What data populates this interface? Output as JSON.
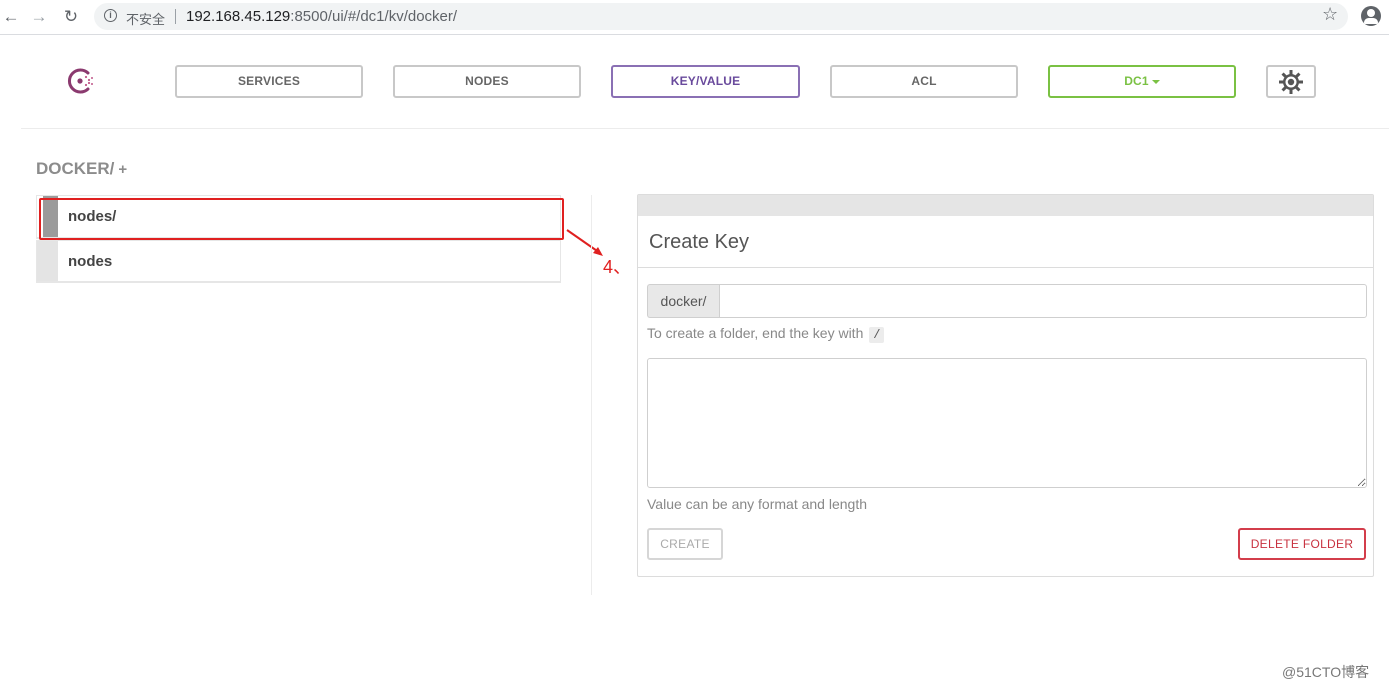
{
  "browser": {
    "security_label": "不安全",
    "url_host": "192.168.45.129",
    "url_rest": ":8500/ui/#/dc1/kv/docker/"
  },
  "nav": {
    "services": "SERVICES",
    "nodes": "NODES",
    "key_value": "KEY/VALUE",
    "acl": "ACL",
    "datacenter": "DC1"
  },
  "breadcrumb": {
    "path": "DOCKER/",
    "add": "+"
  },
  "kv_items": [
    {
      "label": "nodes/"
    },
    {
      "label": "nodes"
    }
  ],
  "annotation": "4、",
  "create_key": {
    "title": "Create Key",
    "key_prefix": "docker/",
    "key_value": "",
    "folder_hint": "To create a folder, end the key with",
    "folder_char": "/",
    "value_text": "",
    "value_hint": "Value can be any format and length",
    "create_label": "CREATE",
    "delete_label": "DELETE FOLDER"
  },
  "watermark": "@51CTO博客",
  "colors": {
    "kv_tab": "#694a9c",
    "dc_tab": "#7ac143",
    "delete": "#c8313f",
    "annotation": "#e02020"
  }
}
